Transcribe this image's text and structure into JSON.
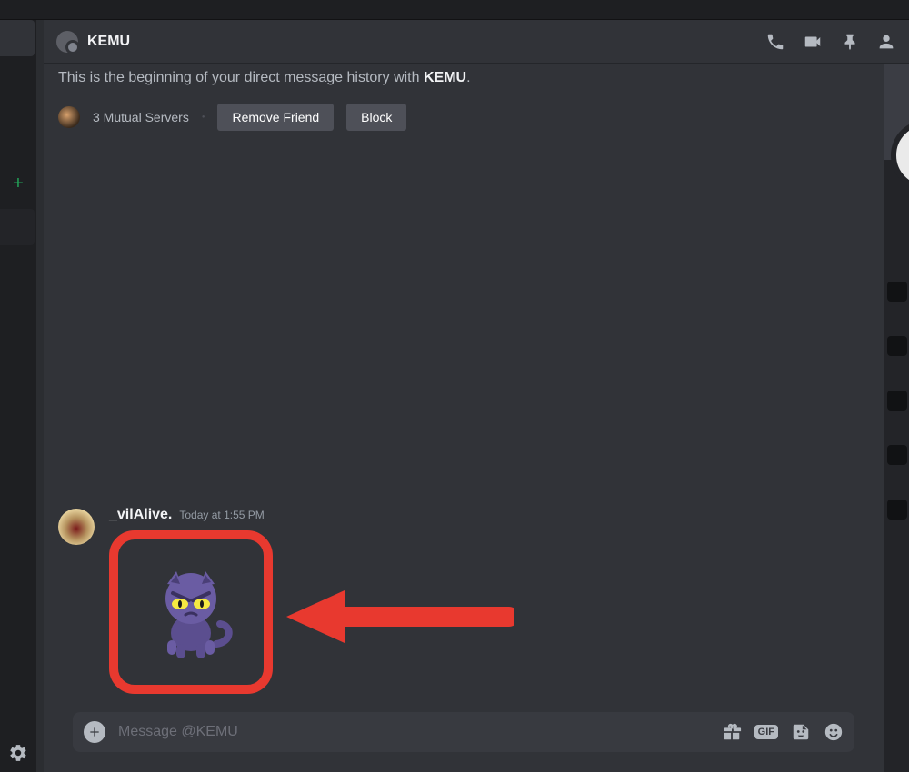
{
  "header": {
    "title": "KEMU"
  },
  "dm_intro": {
    "prefix": "This is the beginning of your direct message history with ",
    "name": "KEMU",
    "suffix": "."
  },
  "mutual": {
    "text": "3 Mutual Servers"
  },
  "buttons": {
    "remove_friend": "Remove Friend",
    "block": "Block"
  },
  "message": {
    "author": "_vilAlive.",
    "timestamp": "Today at 1:55 PM",
    "sticker_name": "angry-purple-cat"
  },
  "composer": {
    "placeholder": "Message @KEMU",
    "gif_label": "GIF"
  },
  "annotation": {
    "highlight_color": "#e8392f"
  },
  "icons": {
    "add_server": "+",
    "settings": "gear-icon",
    "call": "phone-icon",
    "video": "video-icon",
    "pin": "pin-icon",
    "members": "members-icon",
    "attach": "plus-circle-icon",
    "gift": "gift-icon",
    "gif": "gif-icon",
    "sticker": "sticker-icon",
    "emoji": "emoji-icon"
  }
}
